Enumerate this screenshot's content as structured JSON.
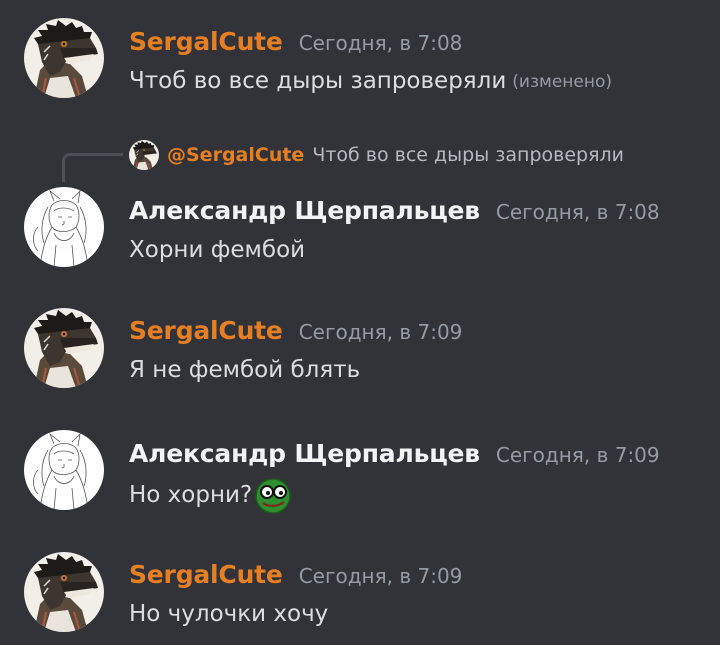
{
  "colors": {
    "background": "#313338",
    "sergal_name": "#e67e22",
    "alex_name": "#f2f3f5",
    "timestamp": "#949ba4",
    "text": "#dbdee1"
  },
  "messages": [
    {
      "author": "SergalCute",
      "avatar": "sergal-avatar",
      "timestamp": "Сегодня, в 7:08",
      "text": "Чтоб во все дыры запроверяли",
      "edited": "(изменено)"
    },
    {
      "author": "Александр Щерпальцев",
      "avatar": "sketch-avatar",
      "timestamp": "Сегодня, в 7:08",
      "text": "Хорни фембой",
      "reply": {
        "mention": "@SergalCute",
        "text": "Чтоб во все дыры запроверяли"
      }
    },
    {
      "author": "SergalCute",
      "avatar": "sergal-avatar",
      "timestamp": "Сегодня, в 7:09",
      "text": "Я не фембой блять"
    },
    {
      "author": "Александр Щерпальцев",
      "avatar": "sketch-avatar",
      "timestamp": "Сегодня, в 7:09",
      "text": "Но хорни?",
      "emoji": "pepe-glasses-emoji"
    },
    {
      "author": "SergalCute",
      "avatar": "sergal-avatar",
      "timestamp": "Сегодня, в 7:09",
      "text": "Но чулочки хочу"
    }
  ]
}
